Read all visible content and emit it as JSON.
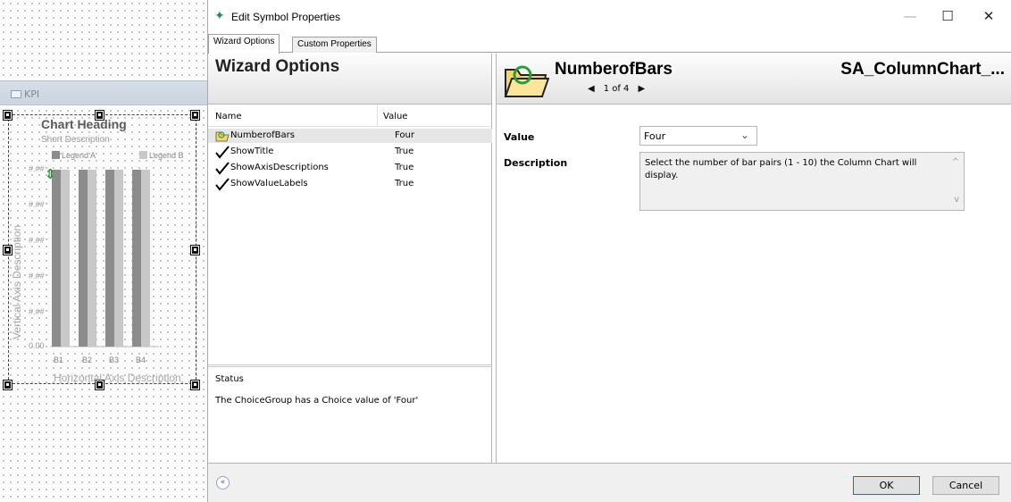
{
  "canvas": {
    "kpi_label": "KPI",
    "chart_heading": "Chart Heading",
    "short_description": "Short Description",
    "legend_a": "Legend A",
    "legend_b": "Legend B",
    "vertical_axis_description": "Vertical Axis Description",
    "horizontal_axis_description": "Horizontal Axis Description",
    "y_ticks": [
      "#.##",
      "#.##",
      "#.##",
      "#.##",
      "#.##",
      "0.00"
    ],
    "x_ticks": [
      "B1",
      "B2",
      "B3",
      "B4"
    ],
    "colors": {
      "bar_dark": "#8c8c8c",
      "bar_light": "#c8c8c8",
      "legend_a": "#8c8c8c",
      "legend_b": "#c8c8c8"
    }
  },
  "dialog": {
    "title": "Edit Symbol Properties",
    "icon": "wizard-wand-icon",
    "window_buttons": {
      "minimize": "—",
      "maximize": "☐",
      "close": "✕"
    },
    "tabs": [
      {
        "label": "Wizard Options",
        "active": true
      },
      {
        "label": "Custom Properties",
        "active": false
      }
    ],
    "left_header": "Wizard Options",
    "right_header": {
      "property_name": "NumberofBars",
      "symbol_name": "SA_ColumnChart_...",
      "pager": "1 of 4"
    },
    "list": {
      "columns": {
        "name": "Name",
        "value": "Value"
      },
      "rows": [
        {
          "name": "NumberofBars",
          "value": "Four",
          "icon": "folder-icon",
          "selected": true
        },
        {
          "name": "ShowTitle",
          "value": "True",
          "icon": "checkmark-icon"
        },
        {
          "name": "ShowAxisDescriptions",
          "value": "True",
          "icon": "checkmark-icon"
        },
        {
          "name": "ShowValueLabels",
          "value": "True",
          "icon": "checkmark-icon"
        }
      ]
    },
    "status": {
      "title": "Status",
      "text": "The ChoiceGroup has a Choice value of 'Four'"
    },
    "details": {
      "value_label": "Value",
      "value_selected": "Four",
      "description_label": "Description",
      "description_text": "Select the number of bar pairs (1 - 10) the Column Chart will display."
    },
    "footer": {
      "collapse": "«",
      "ok": "OK",
      "cancel": "Cancel"
    }
  }
}
